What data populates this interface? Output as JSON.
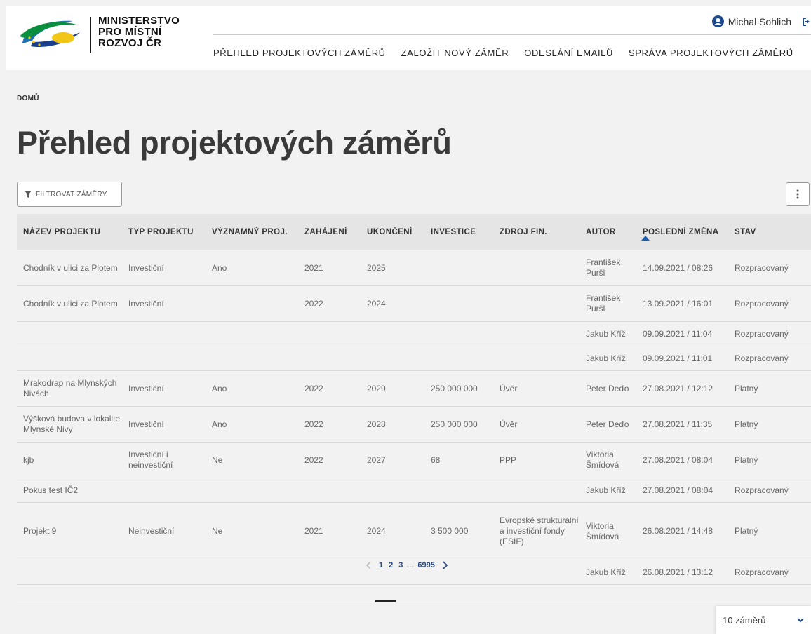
{
  "header": {
    "logo_lines": [
      "MINISTERSTVO",
      "PRO MÍSTNÍ",
      "ROZVOJ ČR"
    ],
    "user_name": "Michal Sohlich",
    "nav": [
      "PŘEHLED PROJEKTOVÝCH ZÁMĚRŮ",
      "ZALOŽIT NOVÝ ZÁMĚR",
      "ODESLÁNÍ EMAILŮ",
      "SPRÁVA PROJEKTOVÝCH ZÁMĚRŮ"
    ]
  },
  "breadcrumb": "DOMŮ",
  "page_title": "Přehled projektových záměrů",
  "toolbar": {
    "filter_label": "FILTROVAT ZÁMĚRY"
  },
  "table": {
    "columns": [
      "NÁZEV PROJEKTU",
      "TYP PROJEKTU",
      "VÝZNAMNÝ PROJ.",
      "ZAHÁJENÍ",
      "UKONČENÍ",
      "INVESTICE",
      "ZDROJ FIN.",
      "AUTOR",
      "POSLEDNÍ ZMĚNA",
      "STAV"
    ],
    "sorted_column": "POSLEDNÍ ZMĚNA",
    "rows": [
      [
        "Chodník v ulici za Plotem",
        "Investiční",
        "Ano",
        "2021",
        "2025",
        "",
        "",
        "František Puršl",
        "14.09.2021 / 08:26",
        "Rozpracovaný"
      ],
      [
        "Chodník v ulici za Plotem",
        "Investiční",
        "",
        "2022",
        "2024",
        "",
        "",
        "František Puršl",
        "13.09.2021 / 16:01",
        "Rozpracovaný"
      ],
      [
        "",
        "",
        "",
        "",
        "",
        "",
        "",
        "Jakub Kříž",
        "09.09.2021 / 11:04",
        "Rozpracovaný"
      ],
      [
        "",
        "",
        "",
        "",
        "",
        "",
        "",
        "Jakub Kříž",
        "09.09.2021 / 11:01",
        "Rozpracovaný"
      ],
      [
        "Mrakodrap na Mlynských Nivách",
        "Investiční",
        "Ano",
        "2022",
        "2029",
        "250 000 000",
        "Úvěr",
        "Peter Deďo",
        "27.08.2021 / 12:12",
        "Platný"
      ],
      [
        "Výšková budova v lokalite Mlynské Nivy",
        "Investiční",
        "Ano",
        "2022",
        "2028",
        "250 000 000",
        "Úvěr",
        "Peter Deďo",
        "27.08.2021 / 11:35",
        "Platný"
      ],
      [
        "kjb",
        "Investiční i neinvestiční",
        "Ne",
        "2022",
        "2027",
        "68",
        "PPP",
        "Viktoria Šmídová",
        "27.08.2021 / 08:04",
        "Platný"
      ],
      [
        "Pokus test IČ2",
        "",
        "",
        "",
        "",
        "",
        "",
        "Jakub Kříž",
        "27.08.2021 / 08:04",
        "Rozpracovaný"
      ],
      [
        "Projekt 9",
        "Neinvestiční",
        "Ne",
        "2021",
        "2024",
        "3 500 000",
        "Evropské strukturální a investiční fondy (ESIF)",
        "Viktoria Šmídová",
        "26.08.2021 / 14:48",
        "Platný"
      ],
      [
        "",
        "",
        "",
        "",
        "",
        "",
        "",
        "Jakub Kříž",
        "26.08.2021 / 13:12",
        "Rozpracovaný"
      ]
    ]
  },
  "pagination": {
    "pages": [
      "1",
      "2",
      "3"
    ],
    "ellipsis": "…",
    "last": "6995"
  },
  "page_size": "10 záměrů",
  "colors": {
    "accent": "#2a4a7a",
    "header_bg": "#e5e5e5",
    "background": "#f2f2f2"
  }
}
